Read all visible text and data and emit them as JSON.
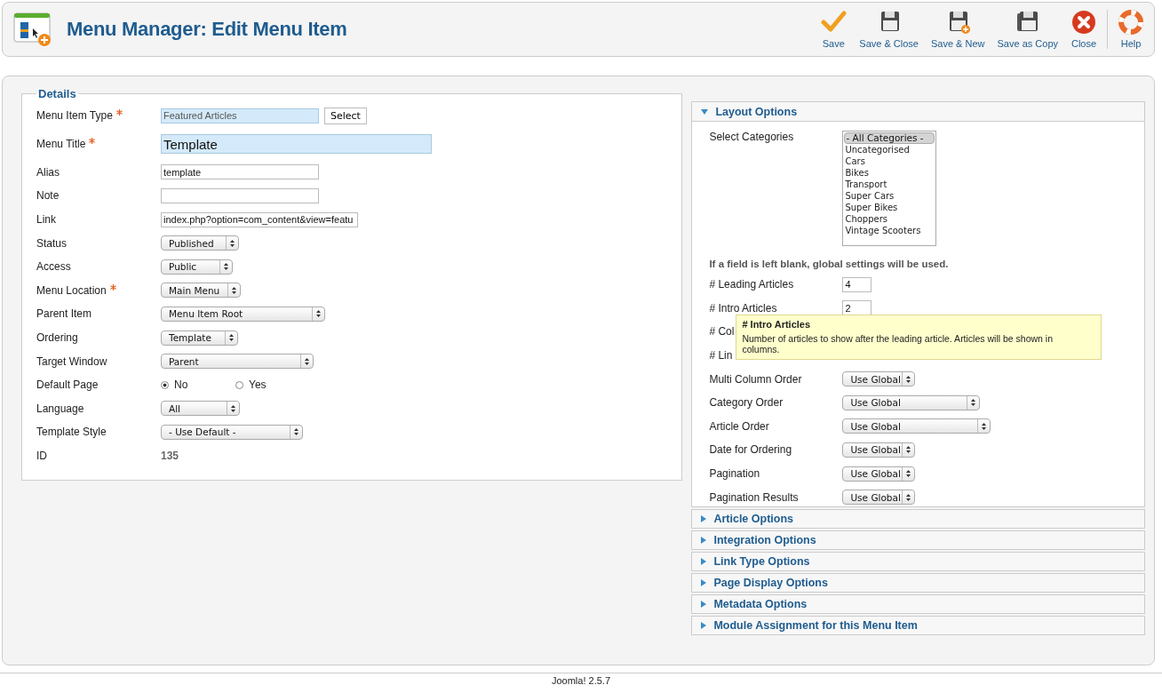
{
  "header": {
    "title": "Menu Manager: Edit Menu Item"
  },
  "toolbar": [
    {
      "kind": "save",
      "label": "Save"
    },
    {
      "kind": "save-close",
      "label": "Save & Close"
    },
    {
      "kind": "save-new",
      "label": "Save & New"
    },
    {
      "kind": "save-copy",
      "label": "Save as Copy"
    },
    {
      "kind": "close",
      "label": "Close"
    },
    {
      "kind": "help",
      "label": "Help"
    }
  ],
  "details": {
    "legend": "Details",
    "fields": [
      {
        "kind": "type",
        "label": "Menu Item Type",
        "required": true,
        "value": "Featured Articles",
        "button": "Select"
      },
      {
        "kind": "title",
        "label": "Menu Title",
        "required": true,
        "value": "Template"
      },
      {
        "kind": "text",
        "label": "Alias",
        "required": false,
        "value": "template"
      },
      {
        "kind": "text",
        "label": "Note",
        "required": false
      },
      {
        "kind": "text",
        "label": "Link",
        "required": false,
        "value": "index.php?option=com_content&view=featu"
      },
      {
        "kind": "select",
        "label": "Status",
        "required": false,
        "value": "Published"
      },
      {
        "kind": "select",
        "label": "Access",
        "required": false,
        "value": "Public"
      },
      {
        "kind": "select",
        "label": "Menu Location",
        "required": true,
        "value": "Main Menu"
      },
      {
        "kind": "select",
        "label": "Parent Item",
        "required": false,
        "value": "Menu Item Root"
      },
      {
        "kind": "select",
        "label": "Ordering",
        "required": false,
        "value": "Template"
      },
      {
        "kind": "select",
        "label": "Target Window",
        "required": false,
        "value": "Parent"
      },
      {
        "kind": "radio",
        "label": "Default Page",
        "required": false,
        "options": [
          {
            "label": "No",
            "selected": true
          },
          {
            "label": "Yes",
            "selected": false
          }
        ]
      },
      {
        "kind": "select",
        "label": "Language",
        "required": false,
        "value": "All"
      },
      {
        "kind": "select",
        "label": "Template Style",
        "required": false,
        "value": "- Use Default -"
      },
      {
        "kind": "static",
        "label": "ID",
        "required": false,
        "value": "135"
      }
    ]
  },
  "layout_options": {
    "title": "Layout Options",
    "expanded": true,
    "items": [
      {
        "kind": "listbox",
        "label": "Select Categories",
        "options": [
          {
            "label": "- All Categories -",
            "selected": true
          },
          {
            "label": "Uncategorised",
            "selected": false
          },
          {
            "label": "Cars",
            "selected": false
          },
          {
            "label": "Bikes",
            "selected": false
          },
          {
            "label": "Transport",
            "selected": false
          },
          {
            "label": "Super Cars",
            "selected": false
          },
          {
            "label": "Super Bikes",
            "selected": false
          },
          {
            "label": "Choppers",
            "selected": false
          },
          {
            "label": "Vintage Scooters",
            "selected": false
          }
        ]
      },
      {
        "kind": "note",
        "text": "If a field is left blank, global settings will be used."
      },
      {
        "kind": "number",
        "label": "# Leading Articles",
        "value": "4"
      },
      {
        "kind": "number",
        "label": "# Intro Articles",
        "value": "2"
      },
      {
        "kind": "covered",
        "label": "# Col"
      },
      {
        "kind": "covered",
        "label": "# Lin"
      },
      {
        "kind": "select",
        "label": "Multi Column Order",
        "value": "Use Global"
      },
      {
        "kind": "select",
        "label": "Category Order",
        "value": "Use Global"
      },
      {
        "kind": "select",
        "label": "Article Order",
        "value": "Use Global"
      },
      {
        "kind": "select",
        "label": "Date for Ordering",
        "value": "Use Global"
      },
      {
        "kind": "select",
        "label": "Pagination",
        "value": "Use Global"
      },
      {
        "kind": "select",
        "label": "Pagination Results",
        "value": "Use Global"
      }
    ],
    "tooltip": {
      "title": "# Intro Articles",
      "text": "Number of articles to show after the leading article. Articles will be shown in columns."
    }
  },
  "panels": [
    {
      "title": "Article Options",
      "expanded": false
    },
    {
      "title": "Integration Options",
      "expanded": false
    },
    {
      "title": "Link Type Options",
      "expanded": false
    },
    {
      "title": "Page Display Options",
      "expanded": false
    },
    {
      "title": "Metadata Options",
      "expanded": false
    },
    {
      "title": "Module Assignment for this Menu Item",
      "expanded": false
    }
  ],
  "footer": "Joomla! 2.5.7"
}
